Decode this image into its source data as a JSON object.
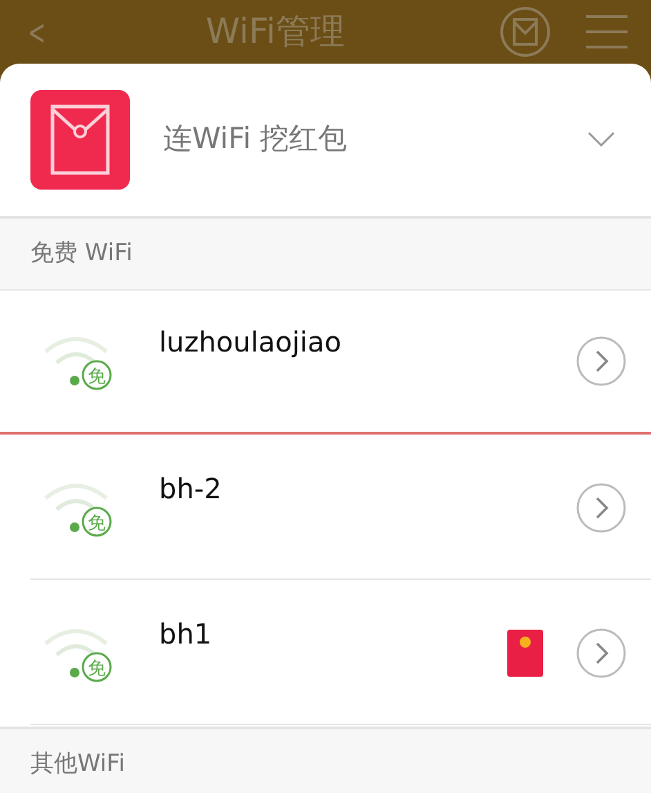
{
  "header": {
    "back": "<",
    "title": "WiFi管理"
  },
  "banner": {
    "text": "连WiFi 挖红包"
  },
  "sections": [
    {
      "title": "免费 WiFi",
      "networks": [
        {
          "name": "luzhoulaojiao",
          "free_label": "免",
          "underlined": true,
          "red_packet": false
        },
        {
          "name": "bh-2",
          "free_label": "免",
          "underlined": false,
          "red_packet": false
        },
        {
          "name": "bh1",
          "free_label": "免",
          "underlined": false,
          "red_packet": true
        }
      ]
    },
    {
      "title": "其他WiFi"
    }
  ]
}
